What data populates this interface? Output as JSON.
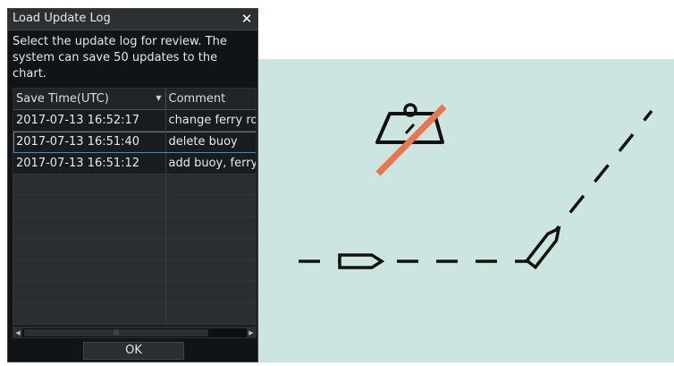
{
  "dialog": {
    "title": "Load Update Log",
    "close_icon": "close-icon",
    "instructions": "Select the update log for review. The system can save 50 updates to the chart.",
    "columns": [
      "Save Time(UTC)",
      "Comment"
    ],
    "rows": [
      {
        "time": "2017-07-13 16:52:17",
        "comment": "change ferry route"
      },
      {
        "time": "2017-07-13 16:51:40",
        "comment": "delete buoy"
      },
      {
        "time": "2017-07-13 16:51:12",
        "comment": "add buoy, ferry"
      }
    ],
    "selected_row": 1,
    "ok_label": "OK"
  },
  "chart": {
    "background": "#cde5e0",
    "symbols": [
      "deleted-buoy-icon",
      "ship-icon",
      "ship-icon",
      "ferry-route-line"
    ],
    "delete_mark_color": "#e8764a"
  }
}
